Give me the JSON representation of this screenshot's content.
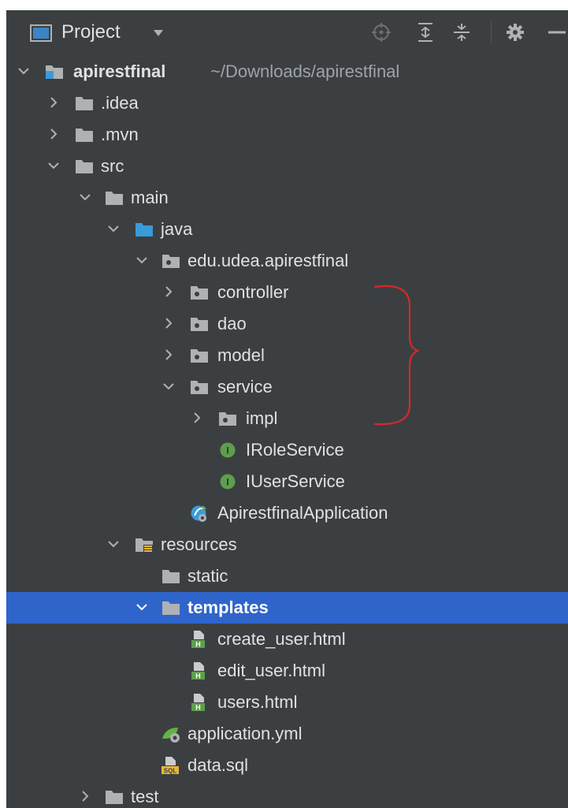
{
  "header": {
    "title": "Project",
    "toolbar": [
      "locate-icon",
      "expand-all-icon",
      "collapse-all-icon",
      "gear-icon",
      "minimize-icon"
    ]
  },
  "tree": [
    {
      "id": "apirestfinal",
      "label": "apirestfinal",
      "path": "~/Downloads/apirestfinal",
      "icon": "module-folder-icon",
      "expand": "expanded",
      "bold": true
    },
    {
      "id": "idea",
      "label": ".idea",
      "icon": "folder-icon",
      "expand": "collapsed"
    },
    {
      "id": "mvn",
      "label": ".mvn",
      "icon": "folder-icon",
      "expand": "collapsed"
    },
    {
      "id": "src",
      "label": "src",
      "icon": "folder-icon",
      "expand": "expanded"
    },
    {
      "id": "main",
      "label": "main",
      "icon": "folder-icon",
      "expand": "expanded"
    },
    {
      "id": "java",
      "label": "java",
      "icon": "source-folder-icon",
      "expand": "expanded"
    },
    {
      "id": "edu-udea-apirestfinal",
      "label": "edu.udea.apirestfinal",
      "icon": "package-icon",
      "expand": "expanded"
    },
    {
      "id": "controller",
      "label": "controller",
      "icon": "package-icon",
      "expand": "collapsed"
    },
    {
      "id": "dao",
      "label": "dao",
      "icon": "package-icon",
      "expand": "collapsed"
    },
    {
      "id": "model",
      "label": "model",
      "icon": "package-icon",
      "expand": "collapsed"
    },
    {
      "id": "service",
      "label": "service",
      "icon": "package-icon",
      "expand": "expanded"
    },
    {
      "id": "impl",
      "label": "impl",
      "icon": "package-icon",
      "expand": "collapsed"
    },
    {
      "id": "irole-service",
      "label": "IRoleService",
      "icon": "interface-icon",
      "expand": "none"
    },
    {
      "id": "iuser-service",
      "label": "IUserService",
      "icon": "interface-icon",
      "expand": "none"
    },
    {
      "id": "apirestfinal-application",
      "label": "ApirestfinalApplication",
      "icon": "spring-boot-class-icon",
      "expand": "none"
    },
    {
      "id": "resources",
      "label": "resources",
      "icon": "resources-folder-icon",
      "expand": "expanded"
    },
    {
      "id": "static",
      "label": "static",
      "icon": "folder-icon",
      "expand": "none"
    },
    {
      "id": "templates",
      "label": "templates",
      "icon": "folder-icon",
      "expand": "expanded",
      "selected": true
    },
    {
      "id": "create-user-html",
      "label": "create_user.html",
      "icon": "html-file-icon",
      "expand": "none"
    },
    {
      "id": "edit-user-html",
      "label": "edit_user.html",
      "icon": "html-file-icon",
      "expand": "none"
    },
    {
      "id": "users-html",
      "label": "users.html",
      "icon": "html-file-icon",
      "expand": "none"
    },
    {
      "id": "application-yml",
      "label": "application.yml",
      "icon": "spring-config-icon",
      "expand": "none"
    },
    {
      "id": "data-sql",
      "label": "data.sql",
      "icon": "sql-file-icon",
      "expand": "none"
    },
    {
      "id": "test",
      "label": "test",
      "icon": "folder-icon",
      "expand": "collapsed"
    }
  ],
  "colors": {
    "background": "#3c3f41",
    "text": "#dfe1e5",
    "selection": "#2f65ca",
    "annotation": "#d42a2a",
    "interface_badge": "#5f9e4e",
    "source_folder": "#3a9bd9"
  },
  "annotation": "hand-drawn-red-brace"
}
